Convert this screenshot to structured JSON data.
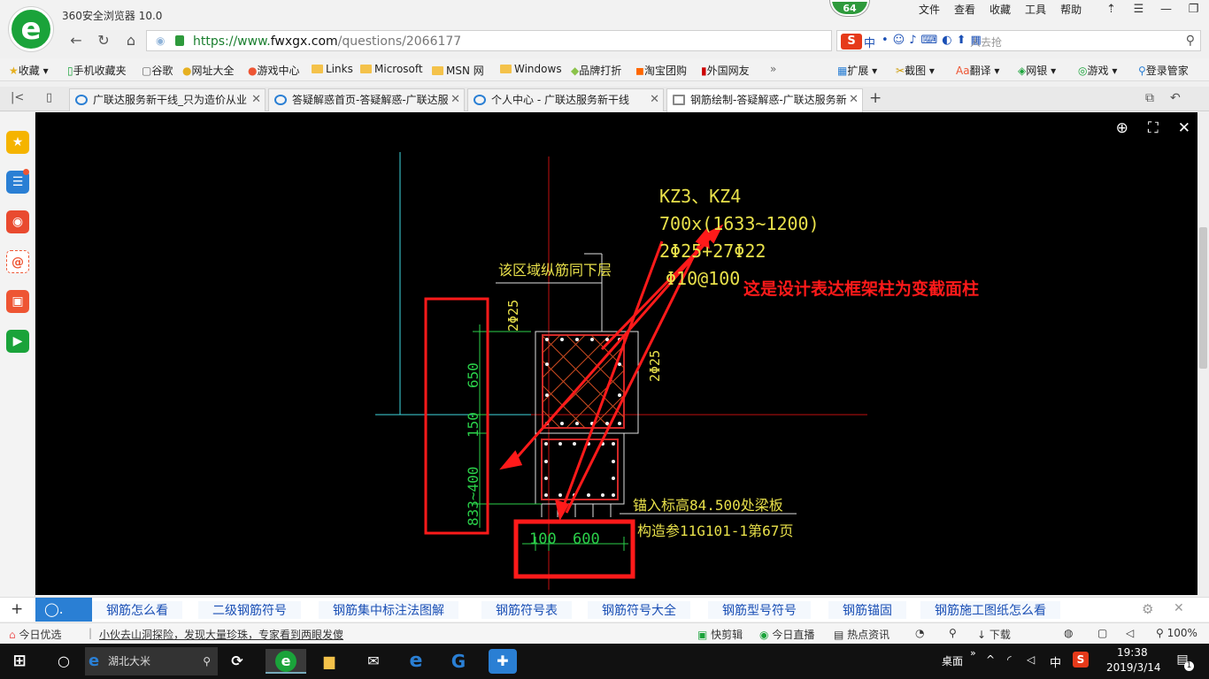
{
  "app": {
    "title": "360安全浏览器 10.0",
    "logo_letter": "e",
    "badge": "64"
  },
  "menu": [
    "文件",
    "查看",
    "收藏",
    "工具",
    "帮助"
  ],
  "address": {
    "scheme": "https://www.",
    "host": "fwxgx.com",
    "path": "/questions/2066177"
  },
  "ime": {
    "label": "中",
    "search_placeholder": "人去抢"
  },
  "bookmarks": [
    {
      "label": "收藏"
    },
    {
      "label": "手机收藏夹"
    },
    {
      "label": "谷歌"
    },
    {
      "label": "网址大全"
    },
    {
      "label": "游戏中心"
    },
    {
      "label": "Links"
    },
    {
      "label": "Microsoft"
    },
    {
      "label": "MSN 网"
    },
    {
      "label": "Windows"
    },
    {
      "label": "品牌打折"
    },
    {
      "label": "淘宝团购"
    },
    {
      "label": "外国网友"
    }
  ],
  "bookmark_tools": [
    "扩展",
    "截图",
    "翻译",
    "网银",
    "游戏",
    "登录管家"
  ],
  "tabs": [
    {
      "label": "广联达服务新干线_只为造价从业"
    },
    {
      "label": "答疑解惑首页-答疑解惑-广联达服"
    },
    {
      "label": "个人中心 - 广联达服务新干线"
    },
    {
      "label": "钢筋绘制-答疑解惑-广联达服务新"
    }
  ],
  "drawing": {
    "col_title": "KZ3、KZ4",
    "col_size": "700x(1633~1200)",
    "col_rebar": "2Φ25+27Φ22",
    "col_stirrup": "Φ10@100",
    "note_zone": "该区域纵筋同下层",
    "annotation": "这是设计表达框架柱为变截面柱",
    "left_rebar": "2Φ25",
    "right_rebar": "2Φ25",
    "dim_650": "650",
    "dim_150": "150",
    "dim_var": "833~400",
    "dim_100": "100",
    "dim_600": "600",
    "anchor_note": "锚入标高84.500处梁板",
    "detail_note": "构造参11G101-1第67页"
  },
  "related": [
    "钢筋怎么看",
    "二级钢筋符号",
    "钢筋集中标注法图解",
    "钢筋符号表",
    "钢筋符号大全",
    "钢筋型号符号",
    "钢筋锚固",
    "钢筋施工图纸怎么看"
  ],
  "status": {
    "today": "今日优选",
    "news": "小伙去山洞探险，发现大量珍珠，专家看到两眼发傻",
    "kuaijian": "快剪辑",
    "live": "今日直播",
    "hot": "热点资讯",
    "download": "下载",
    "zoom": "100%"
  },
  "taskbar": {
    "search_text": "湖北大米",
    "desktop": "桌面",
    "ime": "中",
    "time": "19:38",
    "date": "2019/3/14",
    "notif": "1"
  },
  "colors": {
    "accent_green": "#1aa33a",
    "cad_yellow": "#e8e04a",
    "cad_green": "#2bd04a",
    "annotation_red": "#ff1a1a"
  }
}
